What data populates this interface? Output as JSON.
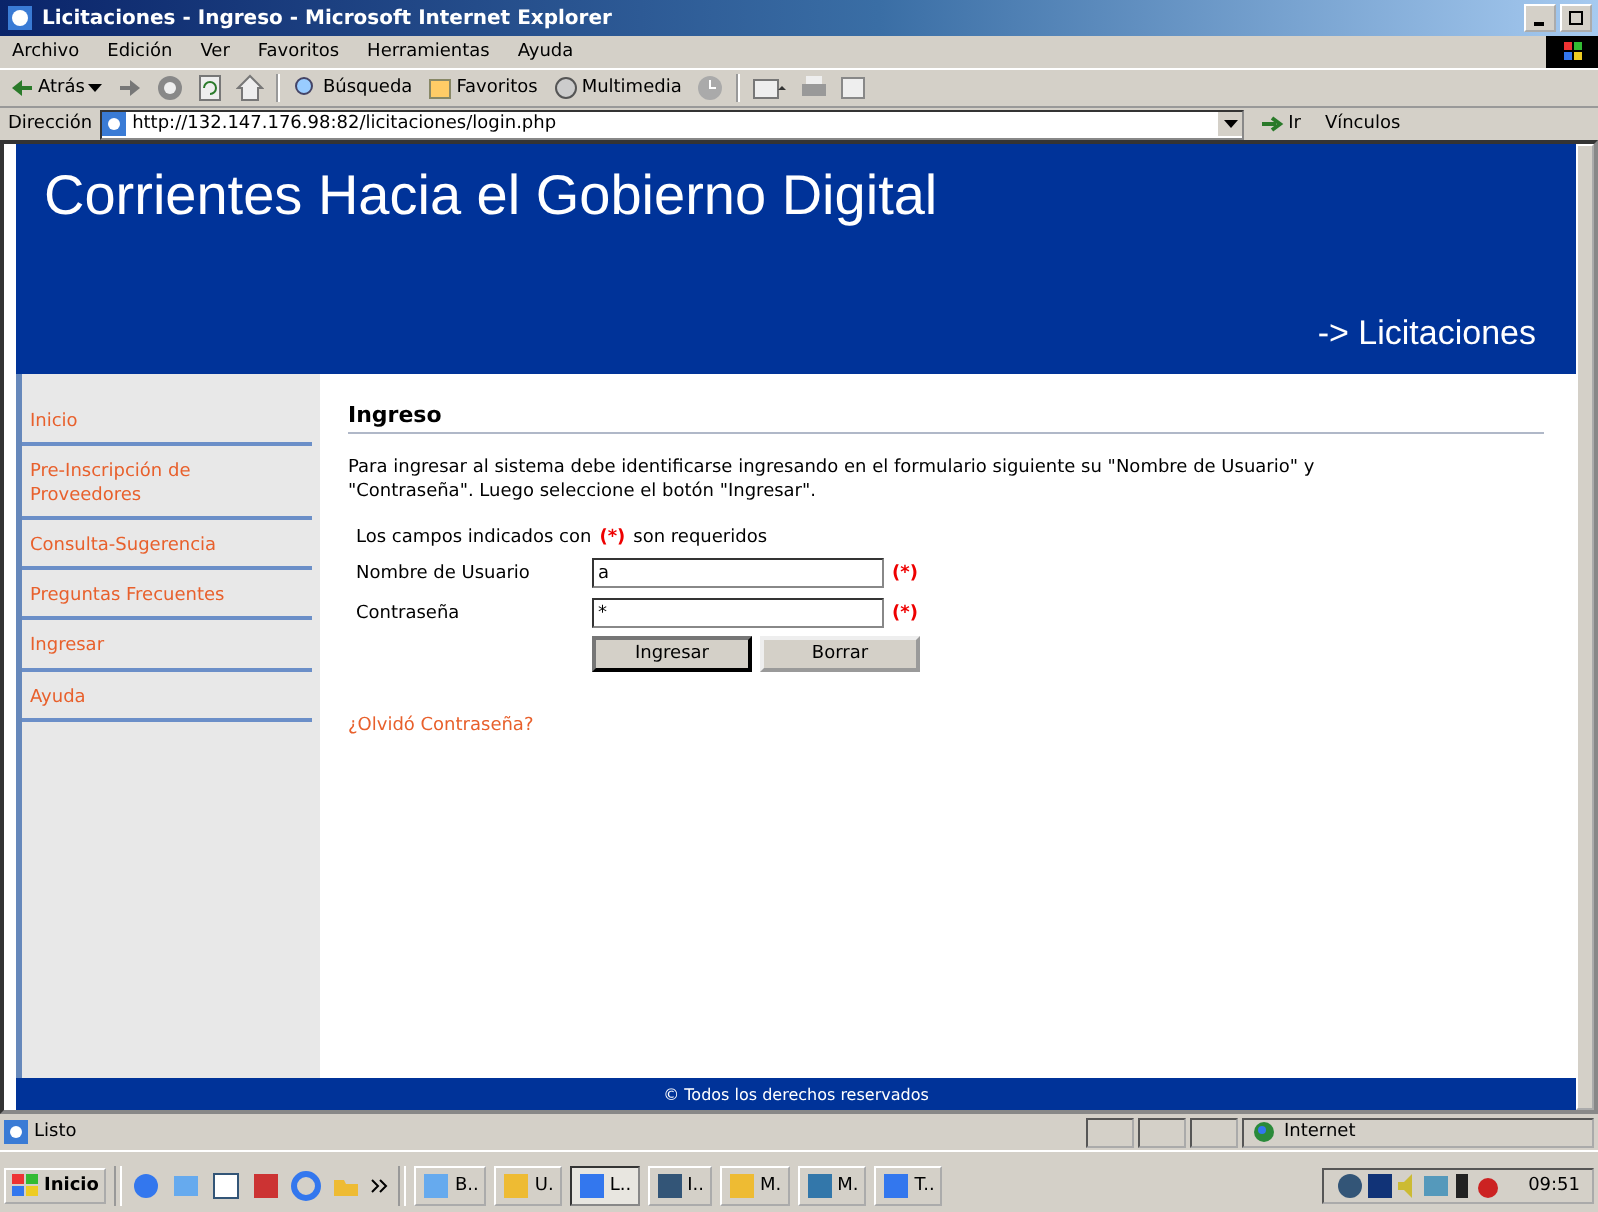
{
  "window": {
    "title": "Licitaciones - Ingreso - Microsoft Internet Explorer"
  },
  "menu": [
    "Archivo",
    "Edición",
    "Ver",
    "Favoritos",
    "Herramientas",
    "Ayuda"
  ],
  "toolbar": {
    "back": "Atrás",
    "search": "Búsqueda",
    "favorites": "Favoritos",
    "media": "Multimedia"
  },
  "address": {
    "label": "Dirección",
    "url": "http://132.147.176.98:82/licitaciones/login.php",
    "go": "Ir",
    "links": "Vínculos"
  },
  "header": {
    "title": "Corrientes Hacia el Gobierno Digital",
    "section": "-> Licitaciones"
  },
  "sidebar": {
    "items": [
      "Inicio",
      "Pre-Inscripción de Proveedores",
      "Consulta-Sugerencia",
      "Preguntas Frecuentes",
      "Ingresar",
      "Ayuda"
    ]
  },
  "content": {
    "heading": "Ingreso",
    "intro": "Para ingresar al sistema debe identificarse ingresando en el formulario siguiente su \"Nombre de Usuario\" y \"Contraseña\". Luego seleccione el botón \"Ingresar\".",
    "required_before": "Los campos indicados con",
    "required_mark": "(*)",
    "required_after": "son requeridos",
    "fields": [
      {
        "label": "Nombre de Usuario",
        "value": "a",
        "mark": "(*)"
      },
      {
        "label": "Contraseña",
        "value": "*",
        "mark": "(*)"
      }
    ],
    "buttons": [
      "Ingresar",
      "Borrar"
    ],
    "forgot_link": "¿Olvidó Contraseña?"
  },
  "footer": "© Todos los derechos reservados",
  "status_bar": {
    "text": "Listo",
    "zone": "Internet"
  },
  "taskbar": {
    "start": "Inicio",
    "tasks": [
      "B..",
      "U.",
      "L..",
      "I..",
      "M.",
      "M.",
      "T.."
    ],
    "clock": "09:51"
  }
}
